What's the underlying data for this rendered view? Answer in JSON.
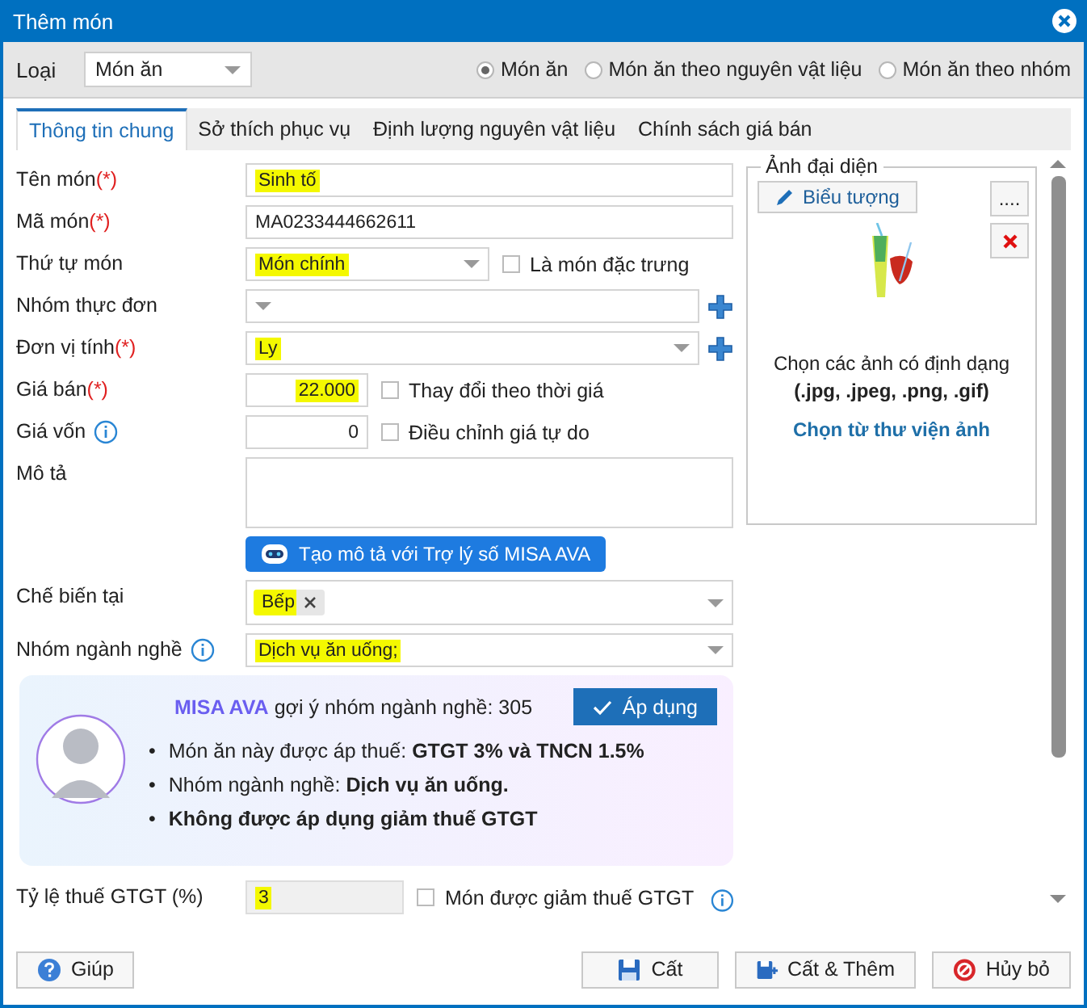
{
  "window": {
    "title": "Thêm món"
  },
  "type_field": {
    "label": "Loại",
    "value": "Món ăn"
  },
  "radios": [
    {
      "label": "Món ăn",
      "selected": true
    },
    {
      "label": "Món ăn theo nguyên vật liệu",
      "selected": false
    },
    {
      "label": "Món ăn theo nhóm",
      "selected": false
    }
  ],
  "tabs": [
    {
      "label": "Thông tin chung",
      "selected": true
    },
    {
      "label": "Sở thích phục vụ",
      "selected": false
    },
    {
      "label": "Định lượng nguyên vật liệu",
      "selected": false
    },
    {
      "label": "Chính sách giá bán",
      "selected": false
    }
  ],
  "fields": [
    {
      "kind": "text",
      "label": "Tên món",
      "required_mark": "(*)",
      "value": "Sinh tố",
      "highlighted": true
    },
    {
      "kind": "text",
      "label": "Mã món",
      "required_mark": "(*)",
      "value": "MA0233444662611",
      "highlighted": false
    },
    {
      "kind": "select_check",
      "label": "Thứ tự món",
      "value": "Món chính",
      "highlighted": true,
      "checkbox": {
        "label": "Là món đặc trưng",
        "checked": false
      }
    },
    {
      "kind": "select_add",
      "label": "Nhóm thực đơn"
    },
    {
      "kind": "select_add",
      "label": "Đơn vị tính",
      "required_mark": "(*)",
      "value": "Ly",
      "highlighted": true
    },
    {
      "kind": "number_check",
      "label": "Giá bán",
      "required_mark": "(*)",
      "value": "22.000",
      "highlighted": true,
      "checkbox": {
        "label": "Thay đổi theo thời giá",
        "checked": false
      }
    },
    {
      "kind": "number_check",
      "label": "Giá vốn",
      "info": true,
      "value": "0",
      "highlighted": false,
      "checkbox": {
        "label": "Điều chỉnh giá tự do",
        "checked": false
      }
    },
    {
      "kind": "textarea",
      "label": "Mô tả"
    },
    {
      "kind": "button",
      "label": "Tạo mô tả với Trợ lý số MISA AVA"
    },
    {
      "kind": "tags",
      "label": "Chế biến tại",
      "tags": [
        {
          "label": "Bếp",
          "highlighted": true
        }
      ]
    },
    {
      "kind": "select",
      "label": "Nhóm ngành nghề",
      "info": true,
      "value": "Dịch vụ ăn uống;",
      "highlighted": true
    },
    {
      "kind": "suggestion",
      "brand": "MISA AVA",
      "text": "gợi ý nhóm ngành nghề: 305",
      "apply_button": "Áp dụng",
      "bullets": [
        {
          "marker": "•",
          "text": "Món ăn này được áp thuế: **GTGT 3% và TNCN 1.5%**",
          "bold": false
        },
        {
          "marker": "•",
          "text": "Nhóm ngành nghề: **Dịch vụ ăn uống.**",
          "bold": false
        },
        {
          "marker": "•",
          "text": "Không được áp dụng giảm thuế GTGT",
          "bold": true
        }
      ]
    },
    {
      "kind": "readonly_check",
      "label": "Tỷ lệ thuế GTGT (%)",
      "value": "3",
      "highlighted": true,
      "checkbox": {
        "label": "Món được giảm thuế GTGT",
        "checked": false,
        "info": true
      }
    }
  ],
  "image_panel": {
    "legend": "Ảnh đại diện",
    "icon_button": "Biểu tượng",
    "browse_button": "....",
    "hint": "Chọn các ảnh có định dạng",
    "formats": "(.jpg, .jpeg, .png, .gif)",
    "library_link": "Chọn từ thư viện ảnh"
  },
  "footer": {
    "help": "Giúp",
    "save": "Cất",
    "save_new": "Cất & Thêm",
    "cancel": "Hủy bỏ"
  }
}
